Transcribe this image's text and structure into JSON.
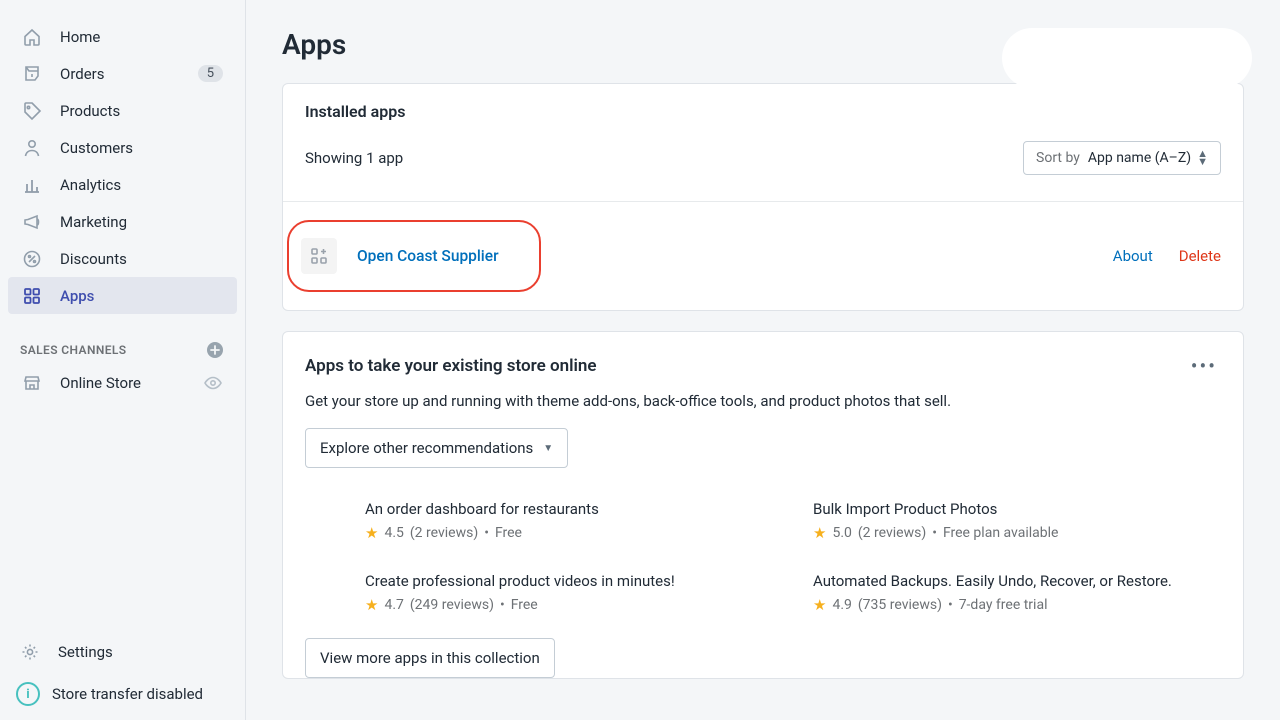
{
  "nav": {
    "items": [
      {
        "label": "Home"
      },
      {
        "label": "Orders",
        "badge": "5"
      },
      {
        "label": "Products"
      },
      {
        "label": "Customers"
      },
      {
        "label": "Analytics"
      },
      {
        "label": "Marketing"
      },
      {
        "label": "Discounts"
      },
      {
        "label": "Apps"
      }
    ],
    "channels_header": "SALES CHANNELS",
    "channels": [
      {
        "label": "Online Store"
      }
    ],
    "settings_label": "Settings",
    "transfer_label": "Store transfer disabled"
  },
  "page": {
    "title": "Apps"
  },
  "installed": {
    "heading": "Installed apps",
    "showing": "Showing 1 app",
    "sort_prefix": "Sort by ",
    "sort_value": "App name (A–Z)",
    "app_name": "Open Coast Supplier",
    "about": "About",
    "delete": "Delete"
  },
  "recs": {
    "title": "Apps to take your existing store online",
    "subtitle": "Get your store up and running with theme add-ons, back-office tools, and product photos that sell.",
    "explore": "Explore other recommendations",
    "view_more": "View more apps in this collection",
    "items": [
      {
        "title": "An order dashboard for restaurants",
        "rating": "4.5",
        "reviews": "(2 reviews)",
        "price": "Free"
      },
      {
        "title": "Bulk Import Product Photos",
        "rating": "5.0",
        "reviews": "(2 reviews)",
        "price": "Free plan available"
      },
      {
        "title": "Create professional product videos in minutes!",
        "rating": "4.7",
        "reviews": "(249 reviews)",
        "price": "Free"
      },
      {
        "title": "Automated Backups. Easily Undo, Recover, or Restore.",
        "rating": "4.9",
        "reviews": "(735 reviews)",
        "price": "7-day free trial"
      }
    ]
  }
}
